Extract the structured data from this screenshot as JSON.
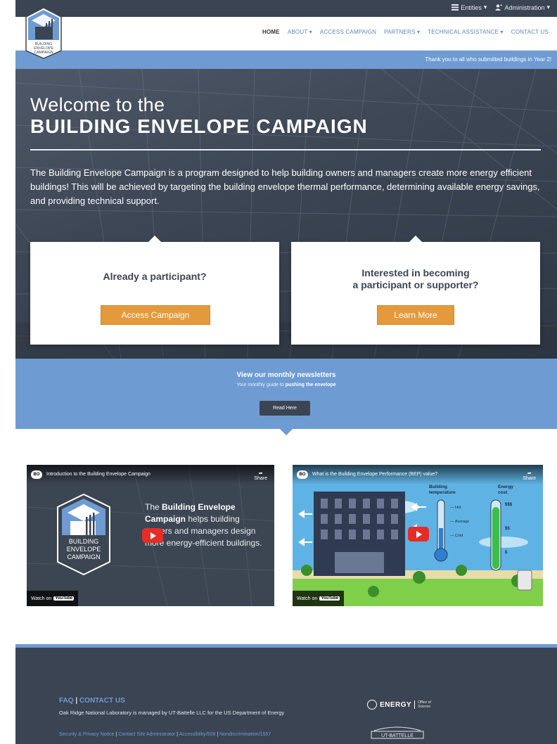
{
  "admin_bar": {
    "entities_label": "Entities",
    "administration_label": "Administration"
  },
  "logo": {
    "text_line1": "BUILDING",
    "text_line2": "ENVELOPE",
    "text_line3": "CAMPAIGN"
  },
  "nav": {
    "items": [
      {
        "label": "HOME"
      },
      {
        "label": "ABOUT ▾"
      },
      {
        "label": "ACCESS CAMPAIGN"
      },
      {
        "label": "PARTNERS ▾"
      },
      {
        "label": "TECHNICAL ASSISTANCE ▾"
      },
      {
        "label": "CONTACT US"
      }
    ]
  },
  "ticker": {
    "text": "Thank you to all who submitted buildings in Year 2!"
  },
  "hero": {
    "title_line1": "Welcome to the",
    "title_line2": "BUILDING ENVELOPE CAMPAIGN",
    "description": "The Building Envelope Campaign is a program designed to help building owners and managers create more energy efficient buildings! This will be achieved by targeting the building envelope thermal performance, determining available energy savings, and providing technical support."
  },
  "cards": {
    "participant": {
      "heading": "Already a participant?",
      "button_label": "Access Campaign"
    },
    "interested": {
      "heading_line1": "Interested in becoming",
      "heading_line2": "a participant or supporter?",
      "button_label": "Learn More"
    }
  },
  "newsletter": {
    "title": "View our monthly newsletters",
    "subtitle_prefix": "Your monthly guide to ",
    "subtitle_bold": "pushing the envelope",
    "button_label": "Read Here"
  },
  "videos": [
    {
      "title": "Introduction to the Building Envelope Campaign",
      "share_label": "Share",
      "watch_label": "Watch on",
      "youtube_label": "YouTube",
      "logo_line1": "BUILDING",
      "logo_line2": "ENVELOPE",
      "logo_line3": "CAMPAIGN",
      "text_bold1": "The ",
      "text_bold2": "Building Envelope Campaign",
      "text_rest": " helps building owners and managers design more energy-efficient buildings."
    },
    {
      "title": "What is the Building Envelope Performance (BEP) value?",
      "share_label": "Share",
      "watch_label": "Watch on",
      "youtube_label": "YouTube",
      "label_temp": "Building temperature",
      "label_cost": "Energy cost",
      "label_hot": "— Hot",
      "label_average": "— Average",
      "label_cold": "— Cold",
      "label_dollars_high": "$$$",
      "label_dollars_mid": "$$",
      "label_dollar_low": "$"
    }
  ],
  "footer": {
    "faq_label": "FAQ",
    "separator": "|",
    "contact_label": "CONTACT US",
    "managed_text": "Oak Ridge National Laboratory is managed by UT-Battelle LLC for the US Department of Energy",
    "links": [
      {
        "label": "Security & Privacy Notice"
      },
      {
        "label": "Contact Site Administrator"
      },
      {
        "label": "Accessibility/508"
      },
      {
        "label": "Nondiscrimination/1557"
      }
    ],
    "doe_label": "ENERGY",
    "doe_office": "Office of Science",
    "utb_label": "UT-BATTELLE"
  },
  "colors": {
    "accent_blue": "#6f9bd3",
    "dark_slate": "#3b4452",
    "orange_button": "#e49a3c"
  }
}
